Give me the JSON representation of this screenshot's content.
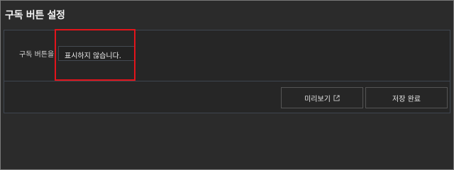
{
  "page": {
    "title": "구독 버튼 설정"
  },
  "form": {
    "subscribe_button_label": "구독 버튼을",
    "subscribe_button_value": "표시하지 않습니다."
  },
  "actions": {
    "preview_label": "미리보기",
    "preview_icon": "external-link-icon",
    "save_label": "저장 완료"
  },
  "colors": {
    "highlight": "#e3141b",
    "background": "#2b2b2b"
  }
}
